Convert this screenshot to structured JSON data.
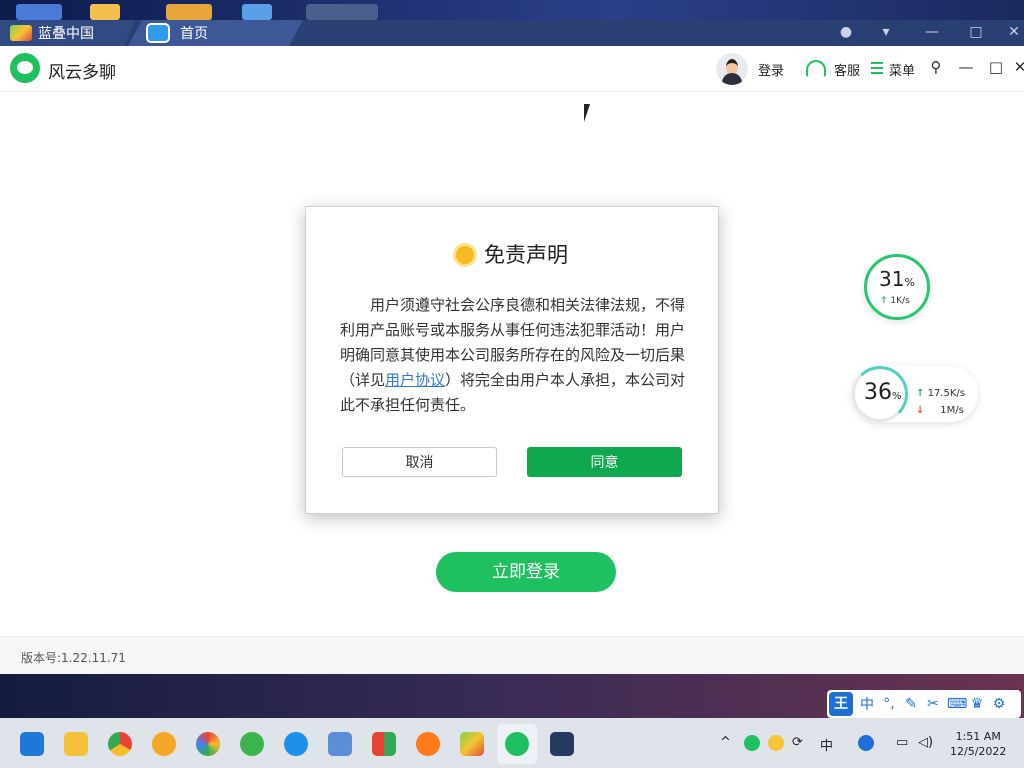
{
  "bluestacks": {
    "tab_main": "蓝叠中国",
    "tab_home": "首页"
  },
  "app": {
    "title": "风云多聊",
    "header": {
      "login_label": "登录",
      "support_label": "客服",
      "menu_label": "菜单"
    },
    "login_button": "立即登录",
    "version": "版本号:1.22.11.71"
  },
  "speed_widgets": {
    "widget1": {
      "percent": "31",
      "percent_sign": "%",
      "speed": "1K/s"
    },
    "widget2": {
      "percent": "36",
      "percent_sign": "%",
      "upload": "17.5K/s",
      "download": "1M/s"
    }
  },
  "dialog": {
    "title": "免责声明",
    "text_before_link": "用户须遵守社会公序良德和相关法律法规，不得利用产品账号或本服务从事任何违法犯罪活动！用户明确同意其使用本公司服务所存在的风险及一切后果（详见",
    "link_text": "用户协议",
    "text_after_link": "）将完全由用户本人承担，本公司对此不承担任何责任。",
    "cancel_label": "取消",
    "agree_label": "同意"
  },
  "ime": {
    "logo": "王",
    "mode": "中",
    "punct": "°,"
  },
  "taskbar": {
    "tray_lang": "中",
    "time": "1:51 AM",
    "date": "12/5/2022"
  },
  "colors": {
    "brand_green": "#1ec05f",
    "agree_green": "#10a84e",
    "link_blue": "#2f7bd6"
  }
}
